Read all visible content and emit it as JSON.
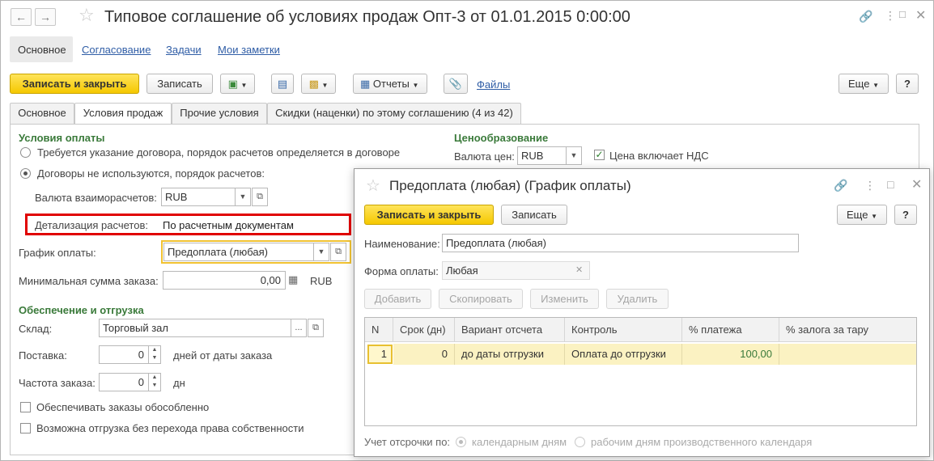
{
  "window": {
    "title": "Типовое соглашение об условиях продаж Опт-3 от 01.01.2015 0:00:00"
  },
  "section_tabs": [
    "Основное",
    "Согласование",
    "Задачи",
    "Мои заметки"
  ],
  "toolbar": {
    "save_close": "Записать и закрыть",
    "save": "Записать",
    "reports": "Отчеты",
    "files": "Файлы",
    "more": "Еще",
    "help": "?"
  },
  "tabs": [
    "Основное",
    "Условия продаж",
    "Прочие условия",
    "Скидки (наценки) по этому соглашению (4 из 42)"
  ],
  "payment": {
    "section": "Условия оплаты",
    "radio1": "Требуется указание договора, порядок расчетов определяется в договоре",
    "radio2": "Договоры не используются, порядок расчетов:",
    "currency_label": "Валюта взаиморасчетов:",
    "currency_value": "RUB",
    "detail_label": "Детализация расчетов:",
    "detail_value": "По расчетным документам",
    "schedule_label": "График оплаты:",
    "schedule_value": "Предоплата (любая)",
    "min_sum_label": "Минимальная сумма заказа:",
    "min_sum_value": "0,00",
    "min_sum_currency": "RUB"
  },
  "pricing": {
    "section": "Ценообразование",
    "currency_label": "Валюта цен:",
    "currency_value": "RUB",
    "vat_label": "Цена включает НДС"
  },
  "shipping": {
    "section": "Обеспечение и отгрузка",
    "warehouse_label": "Склад:",
    "warehouse_value": "Торговый зал",
    "delivery_label": "Поставка:",
    "delivery_value": "0",
    "delivery_suffix": "дней от даты заказа",
    "frequency_label": "Частота заказа:",
    "frequency_value": "0",
    "frequency_suffix": "дн",
    "check1": "Обеспечивать заказы обособленно",
    "check2": "Возможна отгрузка без перехода права собственности"
  },
  "dialog": {
    "title": "Предоплата (любая) (График оплаты)",
    "save_close": "Записать и закрыть",
    "save": "Записать",
    "more": "Еще",
    "help": "?",
    "name_label": "Наименование:",
    "name_value": "Предоплата (любая)",
    "form_label": "Форма оплаты:",
    "form_value": "Любая",
    "add": "Добавить",
    "copy": "Скопировать",
    "change": "Изменить",
    "delete": "Удалить",
    "columns": [
      "N",
      "Срок (дн)",
      "Вариант отсчета",
      "Контроль",
      "% платежа",
      "% залога за тару"
    ],
    "rows": [
      [
        "1",
        "0",
        "до даты отгрузки",
        "Оплата до отгрузки",
        "100,00",
        ""
      ]
    ],
    "delay_label": "Учет отсрочки по:",
    "delay_opt1": "календарным дням",
    "delay_opt2": "рабочим дням производственного календаря"
  },
  "colors": {
    "accent_yellow": "#f5c800",
    "section_green": "#3a7a3a",
    "highlight_red": "#e00000",
    "link_blue": "#2f5da6"
  }
}
